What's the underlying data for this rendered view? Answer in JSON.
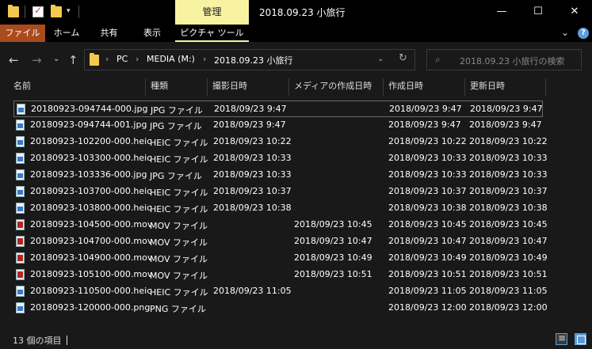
{
  "titlebar": {
    "manage_label": "管理",
    "title": "2018.09.23 小旅行",
    "minimize": "—",
    "maximize": "☐",
    "close": "✕"
  },
  "ribbon": {
    "tabs": [
      "ファイル",
      "ホーム",
      "共有",
      "表示",
      "ピクチャ ツール"
    ],
    "collapse_glyph": "⌄",
    "help_glyph": "?"
  },
  "address": {
    "crumbs": [
      "PC",
      "MEDIA (M:)",
      "2018.09.23 小旅行"
    ],
    "separator": "›"
  },
  "search": {
    "placeholder": "2018.09.23 小旅行の検索"
  },
  "columns": [
    "名前",
    "種類",
    "撮影日時",
    "メディアの作成日時",
    "作成日時",
    "更新日時"
  ],
  "files": [
    {
      "name": "20180923-094744-000.jpg",
      "type": "JPG ファイル",
      "taken": "2018/09/23 9:47",
      "media_created": "",
      "created": "2018/09/23 9:47",
      "modified": "2018/09/23 9:47",
      "icon": "image-file-icon"
    },
    {
      "name": "20180923-094744-001.jpg",
      "type": "JPG ファイル",
      "taken": "2018/09/23 9:47",
      "media_created": "",
      "created": "2018/09/23 9:47",
      "modified": "2018/09/23 9:47",
      "icon": "image-file-icon"
    },
    {
      "name": "20180923-102200-000.heic",
      "type": "HEIC ファイル",
      "taken": "2018/09/23 10:22",
      "media_created": "",
      "created": "2018/09/23 10:22",
      "modified": "2018/09/23 10:22",
      "icon": "image-file-icon"
    },
    {
      "name": "20180923-103300-000.heic",
      "type": "HEIC ファイル",
      "taken": "2018/09/23 10:33",
      "media_created": "",
      "created": "2018/09/23 10:33",
      "modified": "2018/09/23 10:33",
      "icon": "image-file-icon"
    },
    {
      "name": "20180923-103336-000.jpg",
      "type": "JPG ファイル",
      "taken": "2018/09/23 10:33",
      "media_created": "",
      "created": "2018/09/23 10:33",
      "modified": "2018/09/23 10:33",
      "icon": "image-file-icon"
    },
    {
      "name": "20180923-103700-000.heic",
      "type": "HEIC ファイル",
      "taken": "2018/09/23 10:37",
      "media_created": "",
      "created": "2018/09/23 10:37",
      "modified": "2018/09/23 10:37",
      "icon": "image-file-icon"
    },
    {
      "name": "20180923-103800-000.heic",
      "type": "HEIC ファイル",
      "taken": "2018/09/23 10:38",
      "media_created": "",
      "created": "2018/09/23 10:38",
      "modified": "2018/09/23 10:38",
      "icon": "image-file-icon"
    },
    {
      "name": "20180923-104500-000.mov",
      "type": "MOV ファイル",
      "taken": "",
      "media_created": "2018/09/23 10:45",
      "created": "2018/09/23 10:45",
      "modified": "2018/09/23 10:45",
      "icon": "video-file-icon"
    },
    {
      "name": "20180923-104700-000.mov",
      "type": "MOV ファイル",
      "taken": "",
      "media_created": "2018/09/23 10:47",
      "created": "2018/09/23 10:47",
      "modified": "2018/09/23 10:47",
      "icon": "video-file-icon"
    },
    {
      "name": "20180923-104900-000.mov",
      "type": "MOV ファイル",
      "taken": "",
      "media_created": "2018/09/23 10:49",
      "created": "2018/09/23 10:49",
      "modified": "2018/09/23 10:49",
      "icon": "video-file-icon"
    },
    {
      "name": "20180923-105100-000.mov",
      "type": "MOV ファイル",
      "taken": "",
      "media_created": "2018/09/23 10:51",
      "created": "2018/09/23 10:51",
      "modified": "2018/09/23 10:51",
      "icon": "video-file-icon"
    },
    {
      "name": "20180923-110500-000.heic",
      "type": "HEIC ファイル",
      "taken": "2018/09/23 11:05",
      "media_created": "",
      "created": "2018/09/23 11:05",
      "modified": "2018/09/23 11:05",
      "icon": "image-file-icon"
    },
    {
      "name": "20180923-120000-000.png",
      "type": "PNG ファイル",
      "taken": "",
      "media_created": "",
      "created": "2018/09/23 12:00",
      "modified": "2018/09/23 12:00",
      "icon": "image-file-icon"
    }
  ],
  "status": {
    "item_count": "13 個の項目"
  },
  "colors": {
    "background": "#191919",
    "file_tab": "#a94b1d",
    "manage_tab": "#f7f3a1",
    "folder": "#f2c94c"
  }
}
